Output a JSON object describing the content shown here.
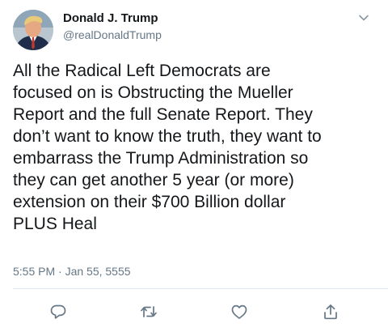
{
  "author": {
    "display_name": "Donald J. Trump",
    "handle": "@realDonaldTrump",
    "avatar_icon": "profile-photo"
  },
  "tweet": {
    "lines": [
      "All the Radical Left Democrats are",
      "focused on is Obstructing the Mueller",
      "Report and the full Senate Report. They",
      "don’t want to know the truth, they want to",
      "embarrass the Trump Administration so",
      "they can get another 5 year (or more)",
      "extension on their $700 Billion dollar",
      "PLUS Heal"
    ],
    "timestamp": "5:55 PM · Jan 55, 5555"
  },
  "actions": {
    "reply_icon": "reply-icon",
    "retweet_icon": "retweet-icon",
    "like_icon": "heart-icon",
    "share_icon": "share-icon"
  },
  "colors": {
    "text": "#14171a",
    "secondary": "#657786",
    "divider": "#e1e8ed"
  }
}
